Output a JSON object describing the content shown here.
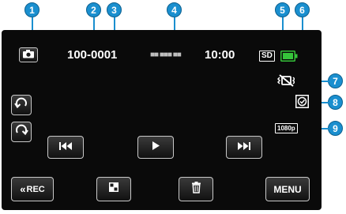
{
  "callouts": [
    "1",
    "2",
    "3",
    "4",
    "5",
    "6",
    "7",
    "8",
    "9"
  ],
  "status": {
    "folder": "100-0001",
    "date_masked": "■■ ■■■ ■■",
    "time": "10:00",
    "media": "SD"
  },
  "resolution": "1080p",
  "buttons": {
    "rec": "REC",
    "menu": "MENU"
  },
  "icons": {
    "mode": "camera-icon",
    "battery": "battery-full-icon",
    "rotate_left": "rotate-left-icon",
    "rotate_right": "rotate-right-icon",
    "previous": "skip-previous-icon",
    "play": "play-icon",
    "next": "skip-next-icon",
    "rec_back": "double-chevron-left-icon",
    "index": "grid-icon",
    "delete": "trash-icon",
    "silent_mode": "vibration-off-icon",
    "protect": "protect-icon"
  },
  "colors": {
    "callout": "#1a8fcf",
    "battery": "#36c43a",
    "screen": "#0a0a0a"
  }
}
